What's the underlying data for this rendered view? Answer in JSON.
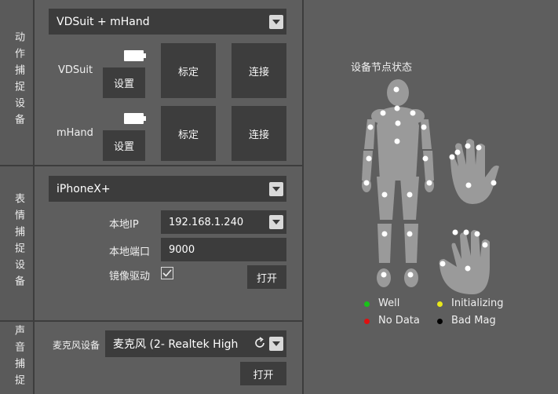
{
  "motion_capture": {
    "section_label": "动作捕捉设备",
    "device_select": "VDSuit + mHand",
    "vdsuit": {
      "label": "VDSuit",
      "settings": "设置",
      "calibrate": "标定",
      "connect": "连接"
    },
    "mhand": {
      "label": "mHand",
      "settings": "设置",
      "calibrate": "标定",
      "connect": "连接"
    }
  },
  "face_capture": {
    "section_label": "表情捕捉设备",
    "device_select": "iPhoneX+",
    "local_ip_label": "本地IP",
    "local_ip_value": "192.168.1.240",
    "local_port_label": "本地端口",
    "local_port_value": "9000",
    "mirror_label": "镜像驱动",
    "mirror_checked": true,
    "open_button": "打开"
  },
  "audio_capture": {
    "section_label": "声音捕捉",
    "mic_label": "麦克风设备",
    "mic_select": "麦克风 (2- Realtek High",
    "open_button": "打开"
  },
  "node_status": {
    "title": "设备节点状态",
    "legend": [
      {
        "label": "Well",
        "color": "#18c318"
      },
      {
        "label": "Initializing",
        "color": "#e8e81a"
      },
      {
        "label": "No Data",
        "color": "#e01010"
      },
      {
        "label": "Bad Mag",
        "color": "#000000"
      }
    ]
  },
  "colors": {
    "background": "#5e5e5e",
    "button": "#3d3d3d",
    "node": "#ffffff",
    "silhouette": "#9a9a9a"
  }
}
